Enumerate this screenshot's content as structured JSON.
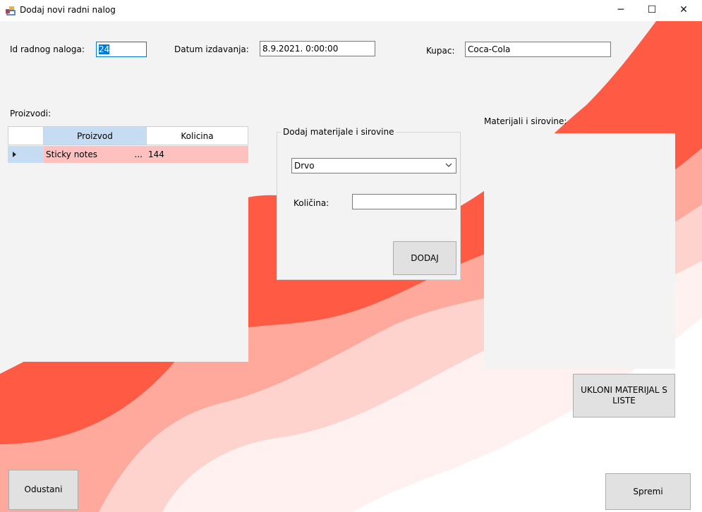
{
  "window": {
    "title": "Dodaj novi radni nalog",
    "icon": "app-form-icon",
    "minimize_glyph": "─",
    "maximize_glyph": "☐",
    "close_glyph": "✕"
  },
  "header": {
    "id_label": "Id radnog naloga:",
    "id_value": "24",
    "date_label": "Datum izdavanja:",
    "date_value": "8.9.2021. 0:00:00",
    "customer_label": "Kupac:",
    "customer_value": "Coca-Cola"
  },
  "products": {
    "label": "Proizvodi:",
    "columns": [
      "Proizvod",
      "Kolicina"
    ],
    "rows": [
      {
        "product": "Sticky notes",
        "ellipsis": "...",
        "quantity": "144"
      }
    ]
  },
  "add_materials": {
    "title": "Dodaj materijale i sirovine",
    "material_selected": "Drvo",
    "quantity_label": "Količina:",
    "quantity_value": "",
    "add_button": "DODAJ"
  },
  "materials": {
    "label": "Materijali i sirovine:",
    "remove_button": "UKLONI MATERIJAL S LISTE"
  },
  "footer": {
    "cancel_button": "Odustani",
    "save_button": "Spremi"
  },
  "colors": {
    "accent": "#0078d7",
    "wave_dark": "#ff5a44",
    "wave_mid": "#ffa89c",
    "wave_light": "#ffe3df",
    "header_selected": "#c5dcf2",
    "row_highlight": "#ffc0c0"
  }
}
